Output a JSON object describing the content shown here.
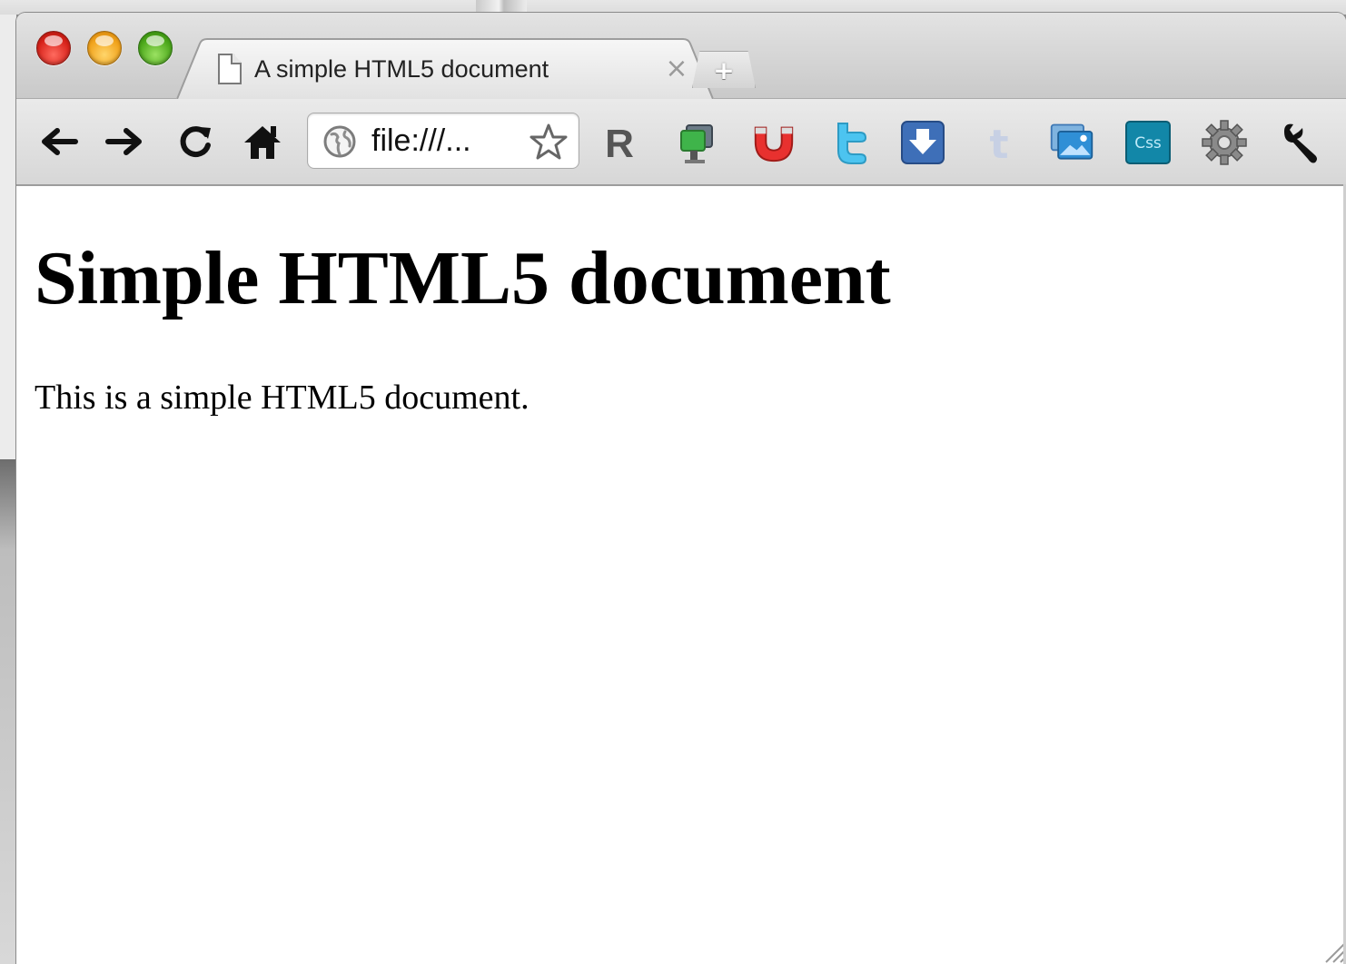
{
  "window": {
    "tab": {
      "title": "A simple HTML5 document",
      "close_glyph": "×"
    },
    "new_tab_glyph": "+"
  },
  "toolbar": {
    "back_glyph": "←",
    "forward_glyph": "→",
    "reload_glyph": "↻",
    "home_glyph": "⌂",
    "address": "file:///..."
  },
  "extensions": [
    {
      "name": "r-icon",
      "glyph": "R"
    },
    {
      "name": "monitor-icon"
    },
    {
      "name": "magnet-icon"
    },
    {
      "name": "twitter-icon"
    },
    {
      "name": "download-icon"
    },
    {
      "name": "tumblr-icon",
      "glyph": "t"
    },
    {
      "name": "image-icon"
    },
    {
      "name": "css-icon",
      "glyph": "Css"
    },
    {
      "name": "gear-icon"
    },
    {
      "name": "wrench-icon"
    }
  ],
  "page": {
    "heading": "Simple HTML5 document",
    "paragraph": "This is a simple HTML5 document."
  }
}
